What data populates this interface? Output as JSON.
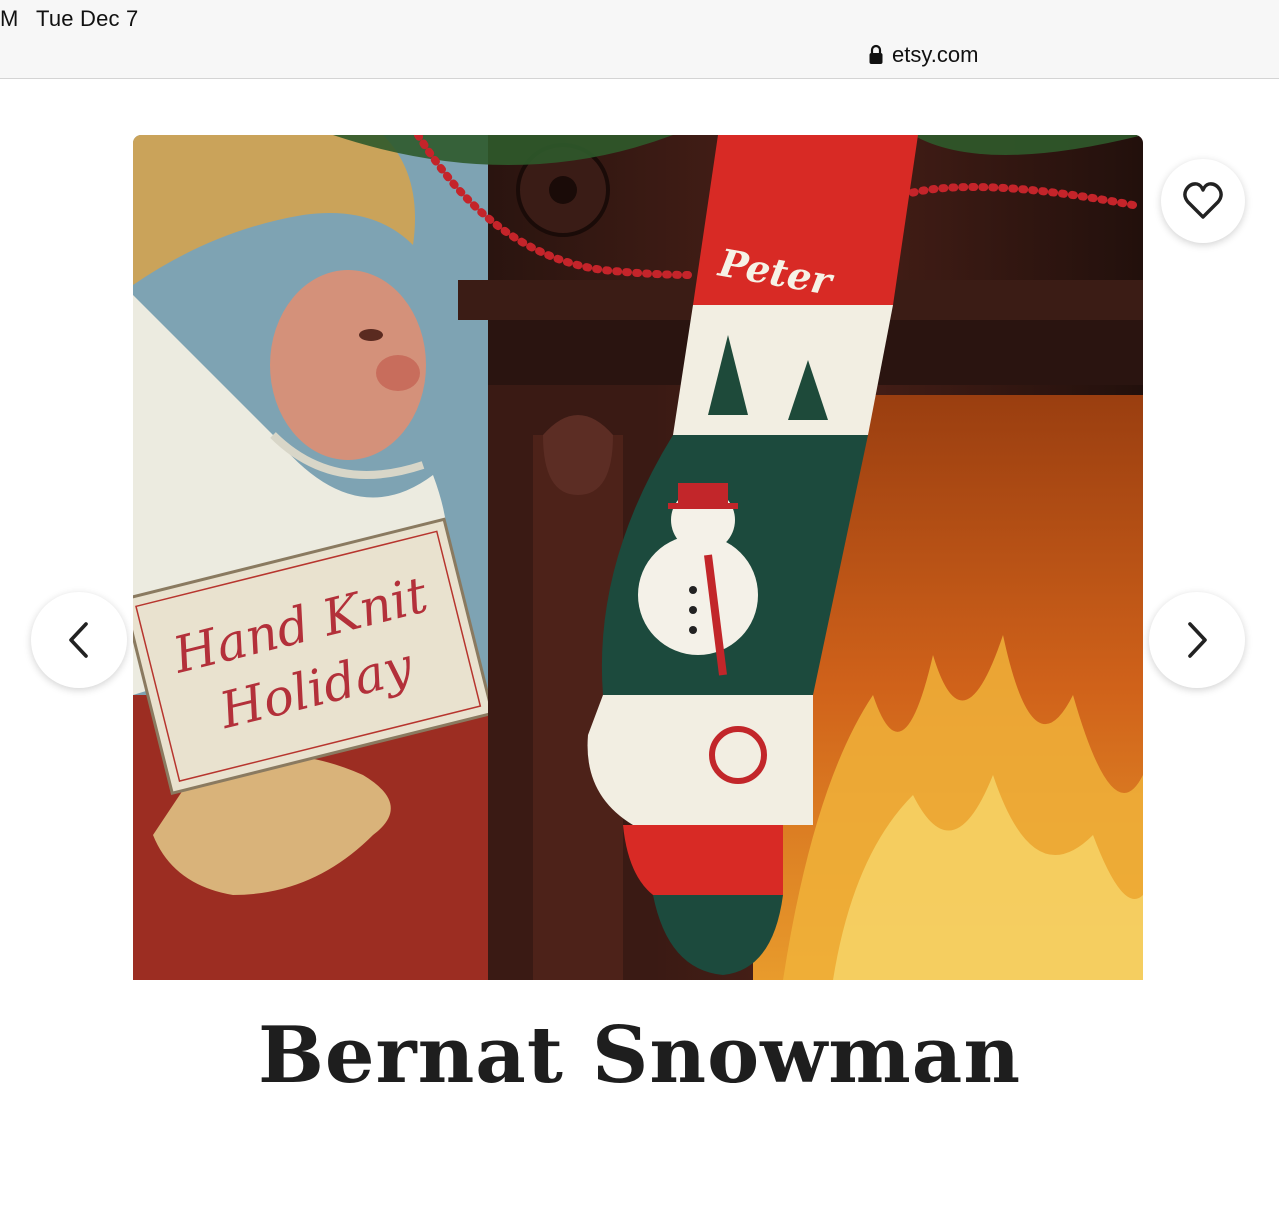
{
  "status_bar": {
    "time": "M",
    "date": "Tue Dec 7"
  },
  "browser": {
    "url": "etsy.com",
    "lock_icon": "lock-icon"
  },
  "listing_image": {
    "santa_sign": [
      "Hand Knit",
      "Holiday"
    ],
    "stocking_name": "Peter"
  },
  "controls": {
    "favorite_icon": "heart-outline-icon",
    "prev_icon": "chevron-left-icon",
    "next_icon": "chevron-right-icon"
  },
  "caption": "Bernat Snowman"
}
